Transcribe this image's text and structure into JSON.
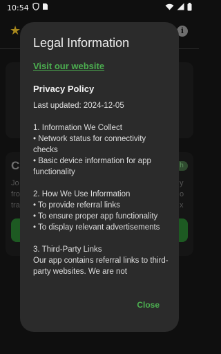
{
  "status_bar": {
    "time": "10:54",
    "left_icons": [
      "shield-icon",
      "sim-card-icon"
    ],
    "right_icons": [
      "wifi-icon",
      "signal-icon",
      "battery-icon"
    ]
  },
  "background": {
    "card_title_initial": "C",
    "card_badge": "h",
    "text_left_1": "Jo",
    "text_left_2": "fro",
    "text_left_3": "tra",
    "text_right_1": "y",
    "text_right_2": "o",
    "text_right_3": "x"
  },
  "dialog": {
    "title": "Legal Information",
    "website_link": "Visit our website",
    "privacy_heading": "Privacy Policy",
    "last_updated": "Last updated: 2024-12-05",
    "sections": [
      {
        "title": "1. Information We Collect",
        "bullets": [
          "• Network status for connectivity checks",
          "• Basic device information for app functionality"
        ]
      },
      {
        "title": "2. How We Use Information",
        "bullets": [
          "• To provide referral links",
          "• To ensure proper app functionality",
          "• To display relevant advertisements"
        ]
      },
      {
        "title": "3. Third-Party Links",
        "paragraph": "Our app contains referral links to third-party websites. We are not"
      }
    ],
    "close_label": "Close"
  },
  "colors": {
    "accent": "#4caf50",
    "dialog_bg": "#2b2b2b",
    "page_bg": "#0f0f0f"
  }
}
